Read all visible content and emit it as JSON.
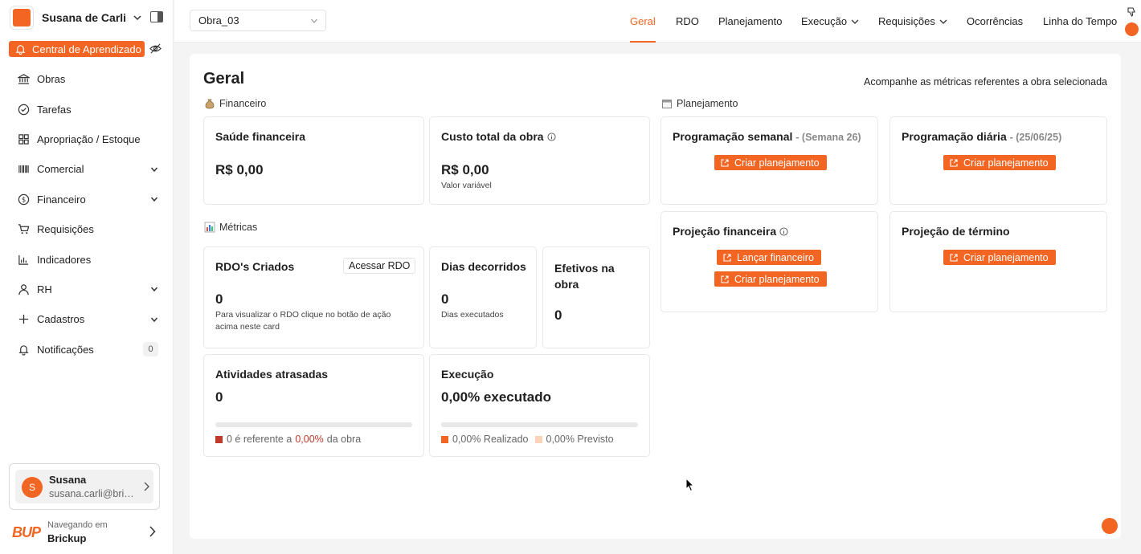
{
  "sidebar": {
    "user_name": "Susana de Carli",
    "learn_label": "Central de Aprendizado",
    "items": [
      {
        "label": "Obras"
      },
      {
        "label": "Tarefas"
      },
      {
        "label": "Apropriação / Estoque"
      },
      {
        "label": "Comercial"
      },
      {
        "label": "Financeiro"
      },
      {
        "label": "Requisições"
      },
      {
        "label": "Indicadores"
      },
      {
        "label": "RH"
      },
      {
        "label": "Cadastros"
      },
      {
        "label": "Notificações",
        "count": "0"
      }
    ],
    "profile": {
      "initial": "S",
      "name": "Susana",
      "email": "susana.carli@brickup.com.br"
    },
    "footer": {
      "small": "Navegando em",
      "name": "Brickup",
      "logo": "BUP"
    }
  },
  "topbar": {
    "obra": "Obra_03",
    "tabs": [
      "Geral",
      "RDO",
      "Planejamento",
      "Execução",
      "Requisições",
      "Ocorrências",
      "Linha do Tempo"
    ]
  },
  "main": {
    "title": "Geral",
    "subtitle": "Acompanhe as métricas referentes a obra selecionada",
    "financeiro": {
      "label": "Financeiro",
      "saude": {
        "title": "Saúde financeira",
        "value": "R$ 0,00"
      },
      "custo": {
        "title": "Custo total da obra",
        "value": "R$ 0,00",
        "note": "Valor variável"
      }
    },
    "metricas": {
      "label": "Métricas",
      "rdo": {
        "title": "RDO's Criados",
        "button": "Acessar RDO",
        "value": "0",
        "note": "Para visualizar o RDO clique no botão de ação acima neste card"
      },
      "dias": {
        "title": "Dias decorridos",
        "value": "0",
        "note": "Dias executados"
      },
      "efetivos": {
        "title": "Efetivos na obra",
        "value": "0"
      },
      "atrasadas": {
        "title": "Atividades atrasadas",
        "value": "0",
        "legend_pre": "0 é referente a",
        "legend_pct": "0,00%",
        "legend_post": "da obra"
      },
      "execucao": {
        "title": "Execução",
        "value": "0,00% executado",
        "realizado": "0,00% Realizado",
        "previsto": "0,00% Previsto"
      }
    },
    "planejamento": {
      "label": "Planejamento",
      "semanal": {
        "title": "Programação semanal",
        "suffix": "- (Semana 26)",
        "button": "Criar planejamento"
      },
      "diaria": {
        "title": "Programação diária",
        "suffix": "- (25/06/25)",
        "button": "Criar planejamento"
      },
      "projecao_fin": {
        "title": "Projeção financeira",
        "button1": "Lançar financeiro",
        "button2": "Criar planejamento"
      },
      "projecao_term": {
        "title": "Projeção de término",
        "button": "Criar planejamento"
      }
    }
  },
  "colors": {
    "accent": "#f26522"
  }
}
